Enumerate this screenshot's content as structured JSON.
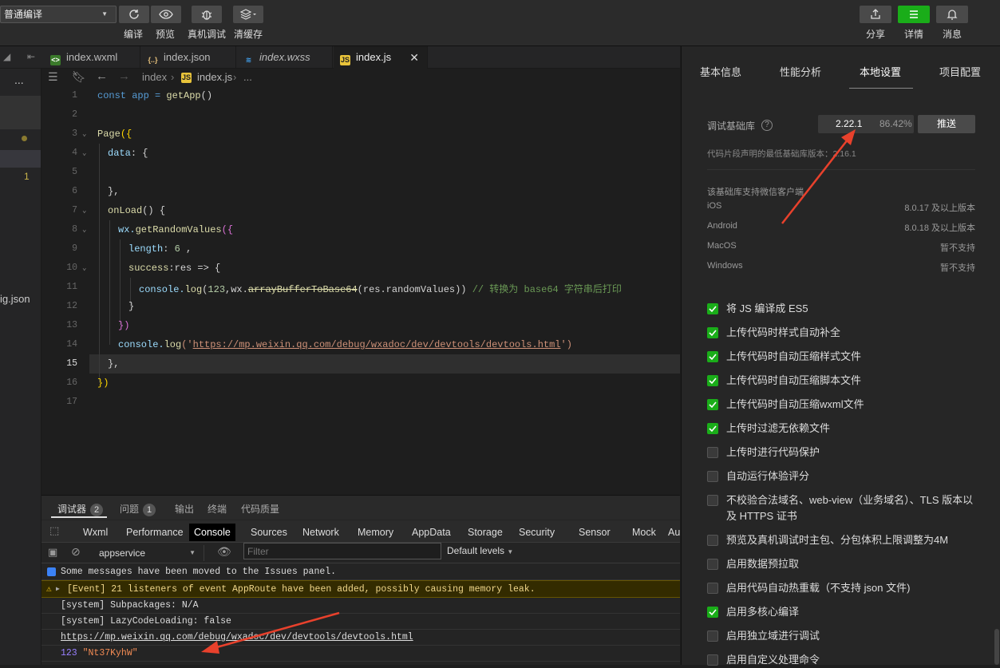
{
  "toolbar": {
    "mode": "普通编译",
    "labels": [
      "编译",
      "预览",
      "真机调试",
      "清缓存"
    ],
    "right_labels": [
      "分享",
      "详情",
      "消息"
    ]
  },
  "tabs": [
    {
      "label": "index.wxml",
      "icon": "wxml-icon"
    },
    {
      "label": "index.json",
      "icon": "json-icon"
    },
    {
      "label": "index.wxss",
      "icon": "css-icon"
    },
    {
      "label": "index.js",
      "icon": "js-icon"
    }
  ],
  "breadcrumb": {
    "folder": "index",
    "file": "index.js",
    "more": "..."
  },
  "left_strip": {
    "dots": "...",
    "count": "1",
    "file_fragment": "ig.json"
  },
  "code": {
    "line_numbers": [
      "1",
      "2",
      "3",
      "4",
      "5",
      "6",
      "7",
      "8",
      "9",
      "10",
      "11",
      "12",
      "13",
      "14",
      "15",
      "16",
      "17"
    ],
    "l1a": "const app = ",
    "l1b": "getApp",
    "l1c": "()",
    "l3a": "Page",
    "l3b": "({",
    "l4a": "data",
    "l4b": ": {",
    "l6": "},",
    "l7a": "onLoad",
    "l7b": "() {",
    "l8a": "wx.",
    "l8b": "getRandomValues",
    "l8c": "({",
    "l9a": "length",
    "l9b": ": ",
    "l9c": "6",
    "l9d": " ,",
    "l10a": "success",
    "l10b": ":res => {",
    "l11a": "console.",
    "l11b": "log",
    "l11c": "(",
    "l11d": "123",
    "l11e": ",wx.",
    "l11f": "arrayBufferToBase64",
    "l11g": "(res.randomValues)) ",
    "l11h": "// 转换为 base64 字符串后打印",
    "l12": "}",
    "l13": "})",
    "l14a": "console.",
    "l14b": "log",
    "l14c": "('",
    "l14d": "https://mp.weixin.qq.com/debug/wxadoc/dev/devtools/devtools.html",
    "l14e": "')",
    "l15": "},",
    "l16": "})"
  },
  "devtools": {
    "tabs": [
      {
        "label": "调试器",
        "badge": "2"
      },
      {
        "label": "问题",
        "badge": "1"
      },
      {
        "label": "输出"
      },
      {
        "label": "终端"
      },
      {
        "label": "代码质量"
      }
    ],
    "panels": [
      "Wxml",
      "Performance",
      "Console",
      "Sources",
      "Network",
      "Memory",
      "AppData",
      "Storage",
      "Security",
      "Sensor",
      "Mock",
      "Au"
    ],
    "context": "appservice",
    "filter_placeholder": "Filter",
    "levels": "Default levels",
    "logs": [
      "Some messages have been moved to the Issues panel.",
      "[Event] 21 listeners of event AppRoute have been added, possibly causing memory leak.",
      "[system] Subpackages: N/A",
      "[system] LazyCodeLoading: false",
      "https://mp.weixin.qq.com/debug/wxadoc/dev/devtools/devtools.html"
    ],
    "result_num": "123",
    "result_str": "\"Nt37KyhW\""
  },
  "right": {
    "tabs": [
      "基本信息",
      "性能分析",
      "本地设置",
      "项目配置"
    ],
    "lib_label": "调试基础库",
    "lib_version": "2.22.1",
    "lib_percent": "86.42%",
    "push": "推送",
    "min_note": "代码片段声明的最低基础库版本：2.16.1",
    "support_title": "该基础库支持微信客户端",
    "platforms": [
      {
        "name": "iOS",
        "value": "8.0.17 及以上版本"
      },
      {
        "name": "Android",
        "value": "8.0.18 及以上版本"
      },
      {
        "name": "MacOS",
        "value": "暂不支持"
      },
      {
        "name": "Windows",
        "value": "暂不支持"
      }
    ],
    "options": [
      {
        "label": "将 JS 编译成 ES5",
        "checked": true
      },
      {
        "label": "上传代码时样式自动补全",
        "checked": true
      },
      {
        "label": "上传代码时自动压缩样式文件",
        "checked": true
      },
      {
        "label": "上传代码时自动压缩脚本文件",
        "checked": true
      },
      {
        "label": "上传代码时自动压缩wxml文件",
        "checked": true
      },
      {
        "label": "上传时过滤无依赖文件",
        "checked": true
      },
      {
        "label": "上传时进行代码保护",
        "checked": false
      },
      {
        "label": "自动运行体验评分",
        "checked": false
      },
      {
        "label": "不校验合法域名、web-view（业务域名）、TLS 版本以及 HTTPS 证书",
        "checked": false
      },
      {
        "label": "预览及真机调试时主包、分包体积上限调整为4M",
        "checked": false
      },
      {
        "label": "启用数据预拉取",
        "checked": false
      },
      {
        "label": "启用代码自动热重载（不支持 json 文件)",
        "checked": false
      },
      {
        "label": "启用多核心编译",
        "checked": true
      },
      {
        "label": "启用独立域进行调试",
        "checked": false
      },
      {
        "label": "启用自定义处理命令",
        "checked": false
      }
    ]
  },
  "colors": {
    "accent": "#1aad19",
    "annotation_arrow": "#e8412c"
  }
}
